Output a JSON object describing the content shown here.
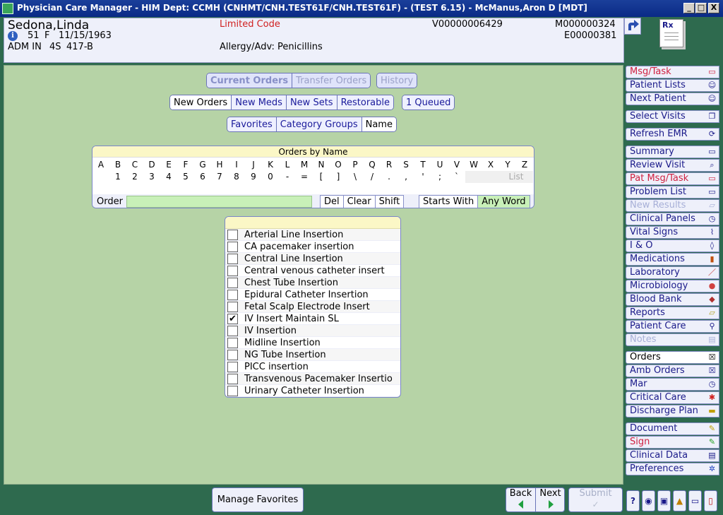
{
  "window": {
    "title": "Physician Care Manager - HIM Dept: CCMH (CNHMT/CNH.TEST61F/CNH.TEST61F) - (TEST 6.15) - McManus,Aron D [MDT]",
    "min_label": "_",
    "max_label": "□",
    "close_label": "X"
  },
  "patient": {
    "name": "Sedona,Linda",
    "age": "51",
    "sex": "F",
    "dob": "11/15/1963",
    "admission": "ADM IN",
    "unit": "4S",
    "room": "417-B",
    "code": "Limited Code",
    "allergy": "Allergy/Adv: Penicillins",
    "visit_id": "V00000006429",
    "mrn": "M000000324",
    "enc": "E00000381",
    "info_icon_glyph": "i"
  },
  "tabs": {
    "row1": [
      "Current Orders",
      "Transfer Orders"
    ],
    "history": "History",
    "row2": [
      "New Orders",
      "New Meds",
      "New Sets",
      "Restorable"
    ],
    "queued": "1 Queued",
    "row3": [
      "Favorites",
      "Category Groups",
      "Name"
    ]
  },
  "orders_by_name": {
    "header": "Orders by Name",
    "letters": [
      "A",
      "B",
      "C",
      "D",
      "E",
      "F",
      "G",
      "H",
      "I",
      "J",
      "K",
      "L",
      "M",
      "N",
      "O",
      "P",
      "Q",
      "R",
      "S",
      "T",
      "U",
      "V",
      "W",
      "X",
      "Y",
      "Z"
    ],
    "symbols": [
      "",
      "1",
      "2",
      "3",
      "4",
      "5",
      "6",
      "7",
      "8",
      "9",
      "0",
      "-",
      "=",
      "[",
      "]",
      "\\",
      "/",
      ".",
      ",",
      "'",
      ";",
      "`",
      "",
      "",
      ""
    ],
    "list_label": "List",
    "order_label": "Order",
    "order_value": "",
    "del": "Del",
    "clear": "Clear",
    "shift": "Shift",
    "starts_with": "Starts With",
    "any_word": "Any Word"
  },
  "order_list": [
    {
      "label": "Arterial Line Insertion",
      "checked": false
    },
    {
      "label": "CA pacemaker insertion",
      "checked": false
    },
    {
      "label": "Central Line Insertion",
      "checked": false
    },
    {
      "label": "Central venous catheter insert",
      "checked": false
    },
    {
      "label": "Chest Tube Insertion",
      "checked": false
    },
    {
      "label": "Epidural Catheter Insertion",
      "checked": false
    },
    {
      "label": "Fetal Scalp Electrode Insert",
      "checked": false
    },
    {
      "label": "IV Insert Maintain SL",
      "checked": true
    },
    {
      "label": "IV Insertion",
      "checked": false
    },
    {
      "label": "Midline Insertion",
      "checked": false
    },
    {
      "label": "NG Tube Insertion",
      "checked": false
    },
    {
      "label": "PICC insertion",
      "checked": false
    },
    {
      "label": "Transvenous Pacemaker Insertio",
      "checked": false
    },
    {
      "label": "Urinary Catheter Insertion",
      "checked": false
    }
  ],
  "check_glyph": "✔",
  "nav": {
    "msg_task": "Msg/Task",
    "patient_lists": "Patient Lists",
    "next_patient": "Next Patient",
    "select_visits": "Select Visits",
    "refresh_emr": "Refresh EMR",
    "summary": "Summary",
    "review_visit": "Review Visit",
    "pat_msg_task": "Pat Msg/Task",
    "problem_list": "Problem List",
    "new_results": "New Results",
    "clinical_panels": "Clinical Panels",
    "vital_signs": "Vital Signs",
    "io": "I & O",
    "medications": "Medications",
    "laboratory": "Laboratory",
    "microbiology": "Microbiology",
    "blood_bank": "Blood Bank",
    "reports": "Reports",
    "patient_care": "Patient Care",
    "notes": "Notes",
    "orders": "Orders",
    "amb_orders": "Amb Orders",
    "mar": "Mar",
    "critical_care": "Critical Care",
    "discharge_plan": "Discharge Plan",
    "document": "Document",
    "sign": "Sign",
    "clinical_data": "Clinical Data",
    "preferences": "Preferences"
  },
  "rx_label": "Rx",
  "bottom": {
    "manage_favorites": "Manage Favorites",
    "back": "Back",
    "next": "Next",
    "submit": "Submit",
    "help": "?"
  },
  "colors": {
    "frame_green": "#2e6a4e",
    "panel_green": "#b6d3a6",
    "title_blue": "#0a2a86",
    "alert_red": "#d02020",
    "input_green": "#c8f0b8",
    "header_yellow": "#fbf7c6"
  }
}
